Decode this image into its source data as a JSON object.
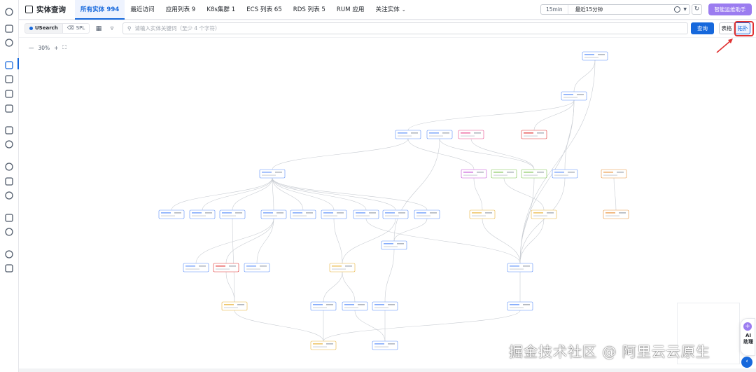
{
  "colors": {
    "accent": "#1668dc",
    "ai": "#9b7cf0",
    "highlight": "#e03131"
  },
  "rail": {
    "icons": [
      "cloud-icon",
      "home-icon",
      "search-icon",
      "entity-query-icon",
      "cube-icon",
      "monitor-icon",
      "alarm-icon",
      "dashboard-icon",
      "settings-icon",
      "cluster-icon",
      "storage-icon",
      "globe-icon",
      "database-icon",
      "target-icon",
      "gear-icon",
      "scan-icon"
    ]
  },
  "header": {
    "title": "实体查询",
    "tabs": [
      {
        "label": "所有实体 994",
        "active": true
      },
      {
        "label": "最近访问"
      },
      {
        "label": "应用列表 9"
      },
      {
        "label": "K8s集群 1"
      },
      {
        "label": "ECS 列表 65"
      },
      {
        "label": "RDS 列表 5"
      },
      {
        "label": "RUM 应用"
      },
      {
        "label": "关注实体"
      }
    ],
    "time_range": "15min",
    "time_label": "最近15分钟",
    "ai_button": "智能运维助手"
  },
  "toolbar": {
    "modes": [
      "USearch",
      "SPL"
    ],
    "search_placeholder": "请输入实体关键词（至少 4 个字符）",
    "query_button": "查询",
    "view_table": "表格",
    "view_topology": "拓扑"
  },
  "canvas": {
    "zoom": "30%"
  },
  "ai_helper": {
    "label": "AI 助理"
  },
  "watermark": "掘金技术社区 @ 阿里云云原生"
}
